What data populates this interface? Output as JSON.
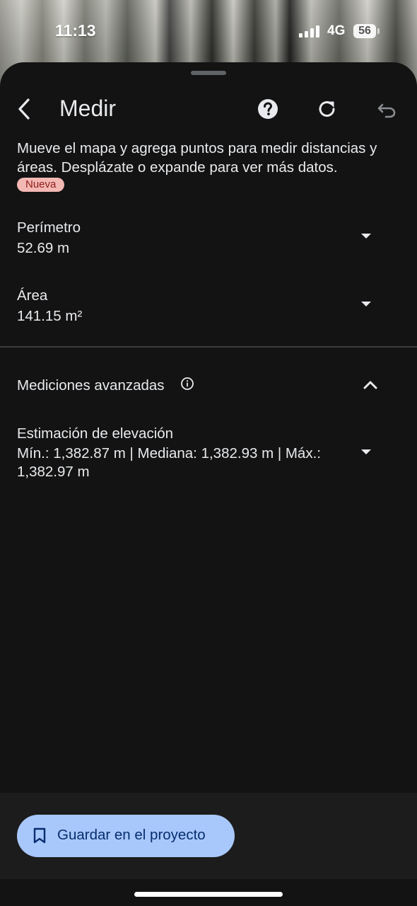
{
  "status_bar": {
    "time": "11:13",
    "network": "4G",
    "battery": "56"
  },
  "header": {
    "title": "Medir",
    "icons": [
      "back-arrow-icon",
      "help-icon",
      "refresh-icon",
      "undo-icon"
    ]
  },
  "intro": {
    "text": "Mueve el mapa y agrega puntos para medir distancias y áreas. Desplázate o expande para ver más datos.",
    "badge": "Nueva"
  },
  "measurements": [
    {
      "label": "Perímetro",
      "value": "52.69 m"
    },
    {
      "label": "Área",
      "value": "141.15 m²"
    }
  ],
  "advanced": {
    "title": "Mediciones avanzadas",
    "elevation": {
      "label": "Estimación de elevación",
      "value": "Mín.: 1,382.87 m | Mediana: 1,382.93 m | Máx.: 1,382.97 m"
    }
  },
  "footer": {
    "save_label": "Guardar en el proyecto"
  },
  "colors": {
    "sheet_bg": "#131313",
    "text": "#e8eaed",
    "badge_bg": "#f4b8b4",
    "badge_text": "#8c1d18",
    "button_bg": "#a8c7fa",
    "button_text": "#062e6f"
  }
}
